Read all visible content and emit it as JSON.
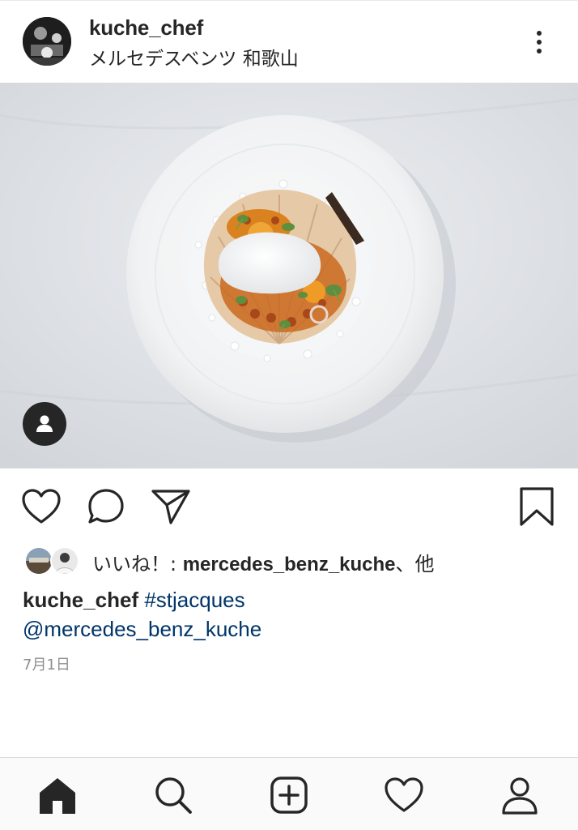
{
  "post": {
    "username": "kuche_chef",
    "location": "メルセデスベンツ 和歌山"
  },
  "likes": {
    "prefix": "いいね！: ",
    "user": "mercedes_benz_kuche",
    "suffix": "、他"
  },
  "caption": {
    "username": "kuche_chef",
    "hashtag": "#stjacques",
    "mention": "@mercedes_benz_kuche"
  },
  "date": "7月1日",
  "icons": {
    "more": "more-vertical-icon",
    "user_tag": "person-icon",
    "like": "heart-outline-icon",
    "comment": "speech-bubble-icon",
    "share": "paper-plane-icon",
    "save": "bookmark-icon"
  },
  "nav": [
    "home-icon",
    "search-icon",
    "add-post-icon",
    "activity-heart-icon",
    "profile-icon"
  ],
  "colors": {
    "text": "#262626",
    "link": "#003569",
    "muted": "#8e8e8e",
    "nav_bg": "#fafafa"
  }
}
